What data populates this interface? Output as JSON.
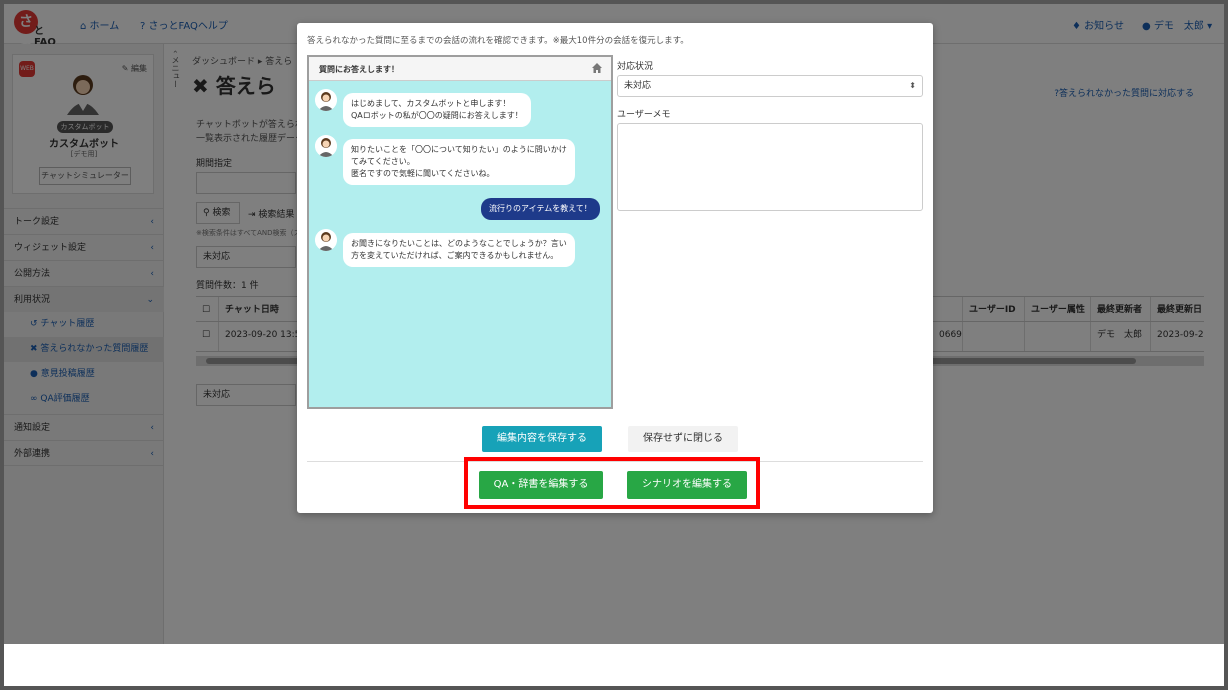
{
  "topbar": {
    "logo_mark": "さっ",
    "logo_text": "とFAQ",
    "home": "ホーム",
    "help": "さっとFAQヘルプ",
    "notice": "お知らせ",
    "user": "デモ　太郎"
  },
  "sidebar": {
    "edit": "編集",
    "bot_tag": "カスタムボット",
    "bot_name": "カスタムボット",
    "bot_sub": "[デモ用]",
    "sim_button": "チャットシミュレーター",
    "items": [
      {
        "label": "トーク設定"
      },
      {
        "label": "ウィジェット設定"
      },
      {
        "label": "公開方法"
      },
      {
        "label": "利用状況"
      },
      {
        "label": "チャット履歴"
      },
      {
        "label": "答えられなかった質問履歴"
      },
      {
        "label": "意見投稿履歴"
      },
      {
        "label": "QA評価履歴"
      },
      {
        "label": "通知設定"
      },
      {
        "label": "外部連携"
      }
    ],
    "collapse_label": "メニュー"
  },
  "main": {
    "breadcrumb": "ダッシュボード ▸ 答えら",
    "title": "答えら",
    "handle_link": "答えられなかった質問に対応する",
    "desc_line1": "チャットボットが答えられ",
    "desc_line2": "一覧表示された履歴データ",
    "period_label": "期間指定",
    "search_btn": "検索",
    "export_btn": "検索結果",
    "search_note": "※検索条件はすべてAND検索（ス",
    "status_select": "未対応",
    "count": "質問件数：1 件",
    "columns": {
      "date": "チャット日時",
      "user_id": "ユーザーID",
      "user_attr": "ユーザー属性",
      "updater": "最終更新者",
      "updated": "最終更新日"
    },
    "row": {
      "date": "2023-09-20 13:5",
      "id_tail": "0669",
      "updater": "デモ　太郎",
      "updated": "2023-09-2"
    },
    "bottom_select": "未対応"
  },
  "modal": {
    "note": "答えられなかった質問に至るまでの会話の流れを確認できます。※最大10件分の会話を復元します。",
    "chat_title": "質問にお答えします！",
    "messages": [
      {
        "from": "bot",
        "lines": [
          "はじめまして、カスタムボットと申します！",
          "QAロボットの私が〇〇の疑問にお答えします！"
        ]
      },
      {
        "from": "bot",
        "lines": [
          "知りたいことを「〇〇について知りたい」のように問いかけ",
          "てみてください。",
          "匿名ですので気軽に聞いてくださいね。"
        ]
      },
      {
        "from": "user",
        "lines": [
          "流行りのアイテムを教えて！"
        ]
      },
      {
        "from": "bot",
        "lines": [
          "お聞きになりたいことは、どのようなことでしょうか？言い",
          "方を変えていただければ、ご案内できるかもしれません。"
        ]
      }
    ],
    "status_label": "対応状況",
    "status_value": "未対応",
    "memo_label": "ユーザーメモ",
    "save_btn": "編集内容を保存する",
    "close_btn": "保存せずに閉じる",
    "qa_btn": "QA・辞書を編集する",
    "scenario_btn": "シナリオを編集する"
  },
  "colors": {
    "accent": "#17a2b8",
    "green": "#28a745",
    "highlight": "#ff0000",
    "chat_bg": "#b2eeee",
    "user_bubble": "#1e3a8a"
  }
}
